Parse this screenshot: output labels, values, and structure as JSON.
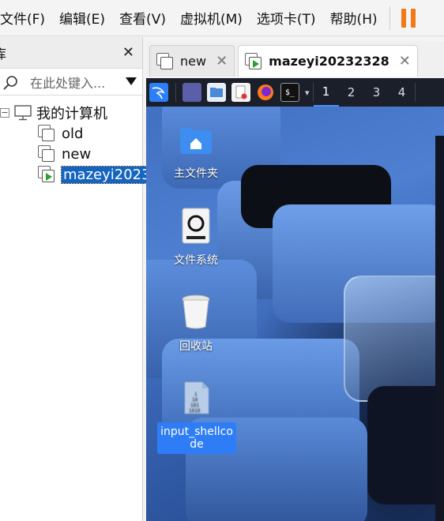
{
  "menu": {
    "items": [
      "文件(F)",
      "编辑(E)",
      "查看(V)",
      "虚拟机(M)",
      "选项卡(T)",
      "帮助(H)"
    ]
  },
  "library": {
    "title": "库",
    "search_placeholder": "在此处键入...",
    "tree": {
      "root": "我的计算机",
      "vms": [
        "old",
        "new",
        "mazeyi2023"
      ]
    }
  },
  "tabs": [
    {
      "label": "new",
      "active": false
    },
    {
      "label": "mazeyi20232328",
      "active": true
    }
  ],
  "taskbar": {
    "workspaces": [
      "1",
      "2",
      "3",
      "4"
    ],
    "active_workspace": "1"
  },
  "desktop": {
    "icons": [
      {
        "label": "主文件夹",
        "icon": "home-folder-icon"
      },
      {
        "label": "文件系统",
        "icon": "drive-icon"
      },
      {
        "label": "回收站",
        "icon": "trash-icon"
      },
      {
        "label_line1": "input_shellco",
        "label_line2": "de",
        "icon": "binary-file-icon",
        "selected": true
      }
    ]
  },
  "colors": {
    "accent": "#1565c0",
    "pause": "#f07a18",
    "selection": "#2f7df6"
  }
}
